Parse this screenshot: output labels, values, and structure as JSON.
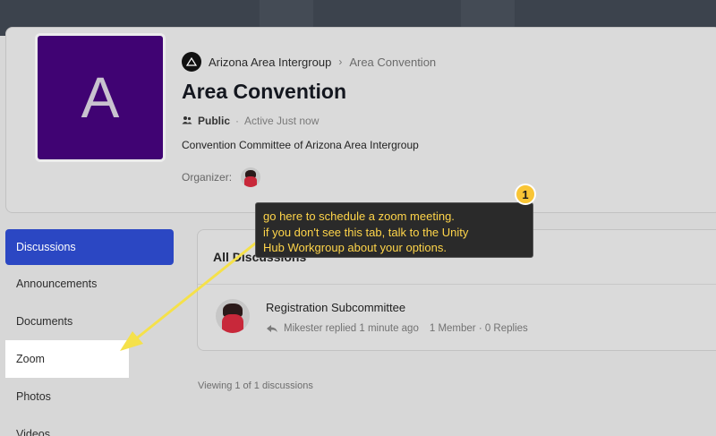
{
  "group": {
    "avatar_letter": "A",
    "parent_name": "Arizona Area Intergroup",
    "breadcrumb_sep": "›",
    "name": "Area Convention",
    "privacy": "Public",
    "separator": "·",
    "activity": "Active Just now",
    "description": "Convention Committee of Arizona Area Intergroup",
    "organizer_label": "Organizer:"
  },
  "nav": {
    "items": [
      {
        "label": "Discussions"
      },
      {
        "label": "Announcements"
      },
      {
        "label": "Documents"
      },
      {
        "label": "Zoom"
      },
      {
        "label": "Photos"
      },
      {
        "label": "Videos"
      }
    ]
  },
  "discussions": {
    "heading": "All Discussions",
    "rows": [
      {
        "title": "Registration Subcommittee",
        "meta": "Mikester replied 1 minute ago",
        "stats": "1 Member · 0 Replies"
      }
    ],
    "viewing": "Viewing 1 of 1 discussions"
  },
  "callout": {
    "step": "1",
    "line1": "go here to schedule a zoom meeting.",
    "line2": "if you don't see this tab, talk to the Unity",
    "line3": "Hub Workgroup about your options."
  },
  "colors": {
    "avatar_bg": "#400373",
    "nav_active": "#2b47c3",
    "callout_text": "#ffd54a",
    "callout_bg": "#2a2a2a",
    "badge": "#f9c535",
    "arrow": "#f5e14a"
  }
}
